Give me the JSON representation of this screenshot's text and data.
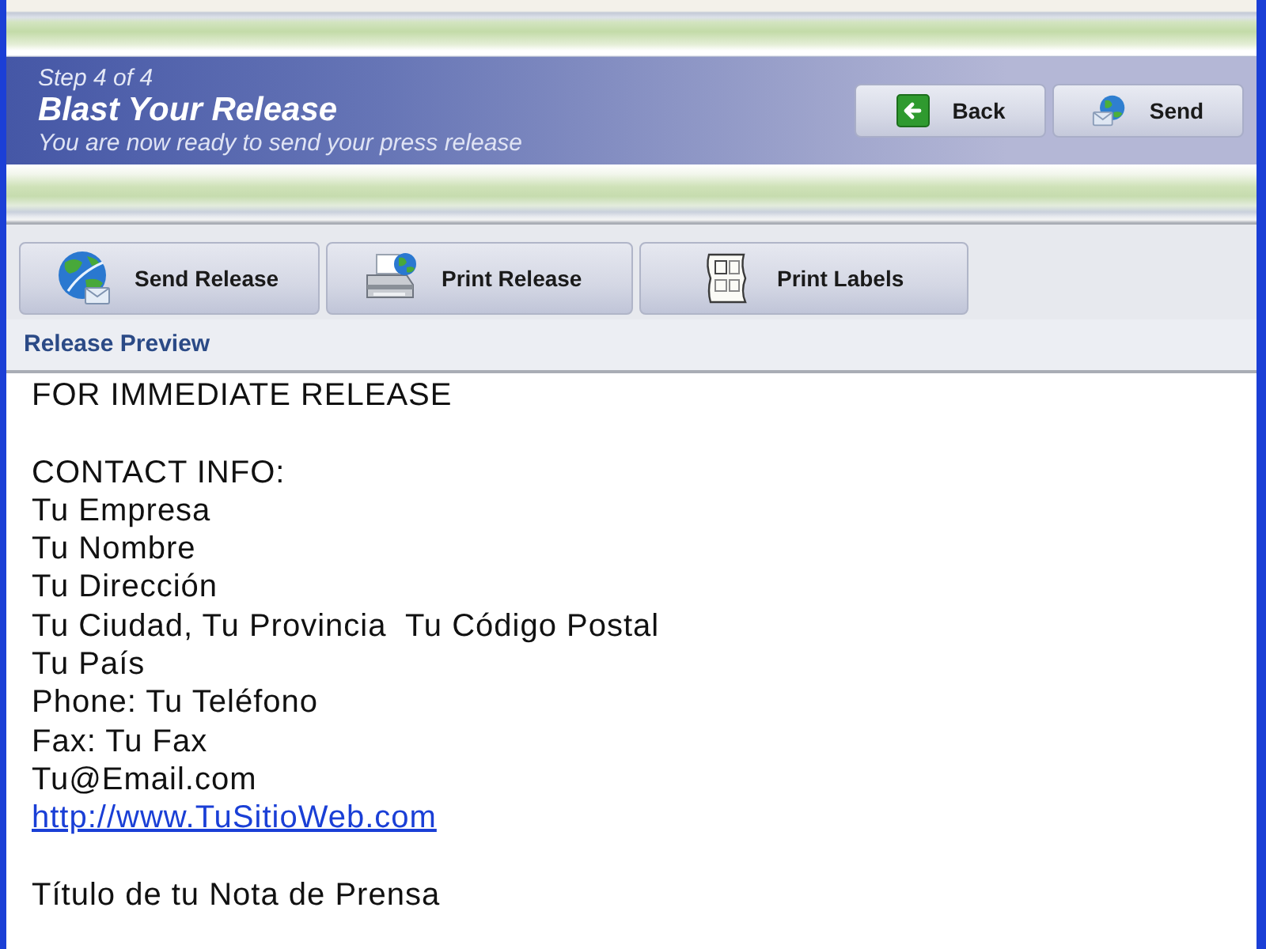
{
  "wizard": {
    "step": "Step 4 of 4",
    "title": "Blast Your Release",
    "subtitle": "You are now ready to send your press release"
  },
  "nav_buttons": [
    {
      "kind": "back",
      "label": "Back"
    },
    {
      "kind": "send",
      "label": "Send"
    }
  ],
  "toolbar": [
    {
      "kind": "globe",
      "label": "Send Release"
    },
    {
      "kind": "printer",
      "label": "Print Release"
    },
    {
      "kind": "labels",
      "label": "Print Labels"
    }
  ],
  "preview": {
    "heading": "Release Preview",
    "paragraphs": [
      [
        {
          "kind": "text",
          "text": "FOR IMMEDIATE RELEASE"
        }
      ],
      [
        {
          "kind": "text",
          "text": "CONTACT INFO:"
        },
        {
          "kind": "text",
          "text": "Tu Empresa"
        },
        {
          "kind": "text",
          "text": "Tu Nombre"
        },
        {
          "kind": "text",
          "text": "Tu Dirección"
        },
        {
          "kind": "text",
          "text": "Tu Ciudad, Tu Provincia  Tu Código Postal"
        },
        {
          "kind": "text",
          "text": "Tu País"
        },
        {
          "kind": "text",
          "text": "Phone: Tu Teléfono"
        },
        {
          "kind": "text",
          "text": "Fax: Tu Fax"
        },
        {
          "kind": "text",
          "text": "Tu@Email.com"
        },
        {
          "kind": "link",
          "text": "http://www.TuSitioWeb.com"
        }
      ],
      [
        {
          "kind": "text",
          "text": "Título de tu Nota de Prensa"
        }
      ]
    ]
  }
}
